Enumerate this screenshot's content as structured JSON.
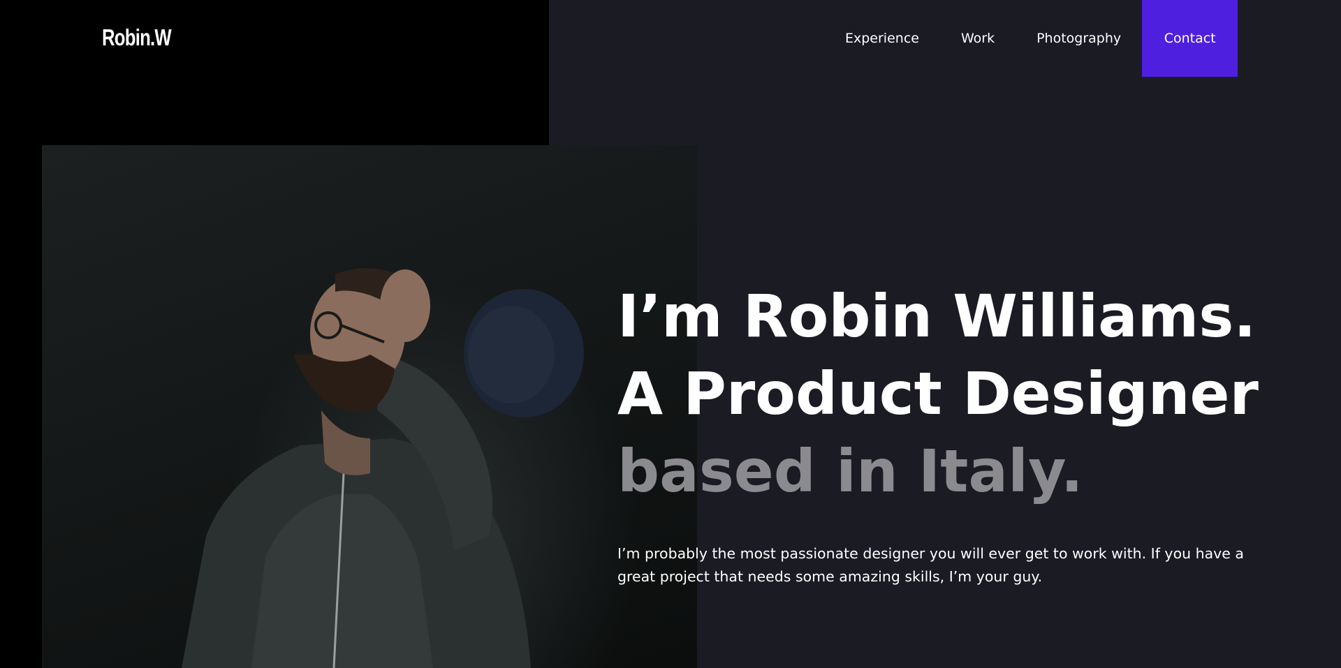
{
  "brand": {
    "logo": "Robin.W"
  },
  "nav": {
    "items": [
      {
        "label": "Experience"
      },
      {
        "label": "Work"
      },
      {
        "label": "Photography"
      },
      {
        "label": "Contact"
      }
    ]
  },
  "hero": {
    "line1": "I’m Robin Williams.",
    "line2": "A Product Designer",
    "line3": "based in Italy.",
    "intro": "I’m probably the most passionate designer you will ever get to work with. If you have a great project that needs some amazing skills, I’m your guy."
  },
  "colors": {
    "accent": "#4f1fe0",
    "background": "#1b1b24",
    "left_panel": "#000000",
    "muted_text": "#8a8a8f"
  },
  "icons": {
    "portrait": "person-photo"
  }
}
